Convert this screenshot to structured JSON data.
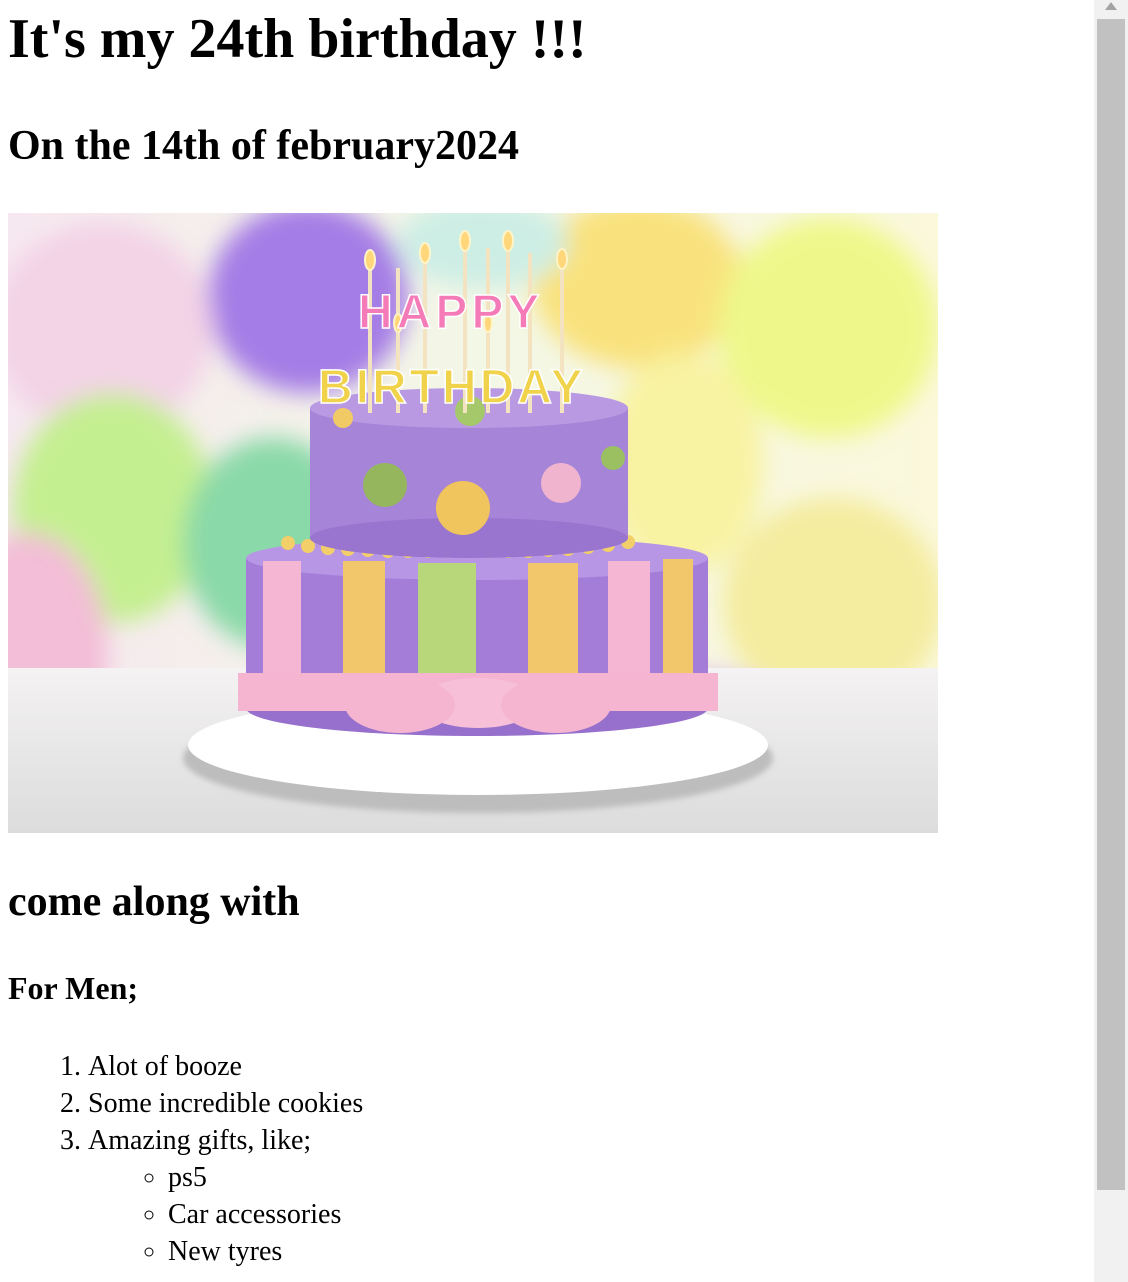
{
  "page": {
    "heading": "It's my 24th birthday !!!",
    "date_line": "On the 14th of february2024",
    "image": {
      "description": "two-tier birthday cake with candles, balloons behind",
      "candle_line1": "HAPPY",
      "candle_line2": "BIRTHDAY"
    },
    "come_along": "come along with",
    "for_men": "For Men;",
    "items": [
      "Alot of booze",
      "Some incredible cookies",
      "Amazing gifts, like;"
    ],
    "gifts": [
      "ps5",
      "Car accessories",
      "New tyres"
    ]
  },
  "colors": {
    "background": "#ffffff",
    "text": "#000000",
    "scroll_track": "#f1f1f1",
    "scroll_thumb": "#c1c1c1"
  },
  "icons": {
    "scroll_up": "triangle-up-icon"
  }
}
